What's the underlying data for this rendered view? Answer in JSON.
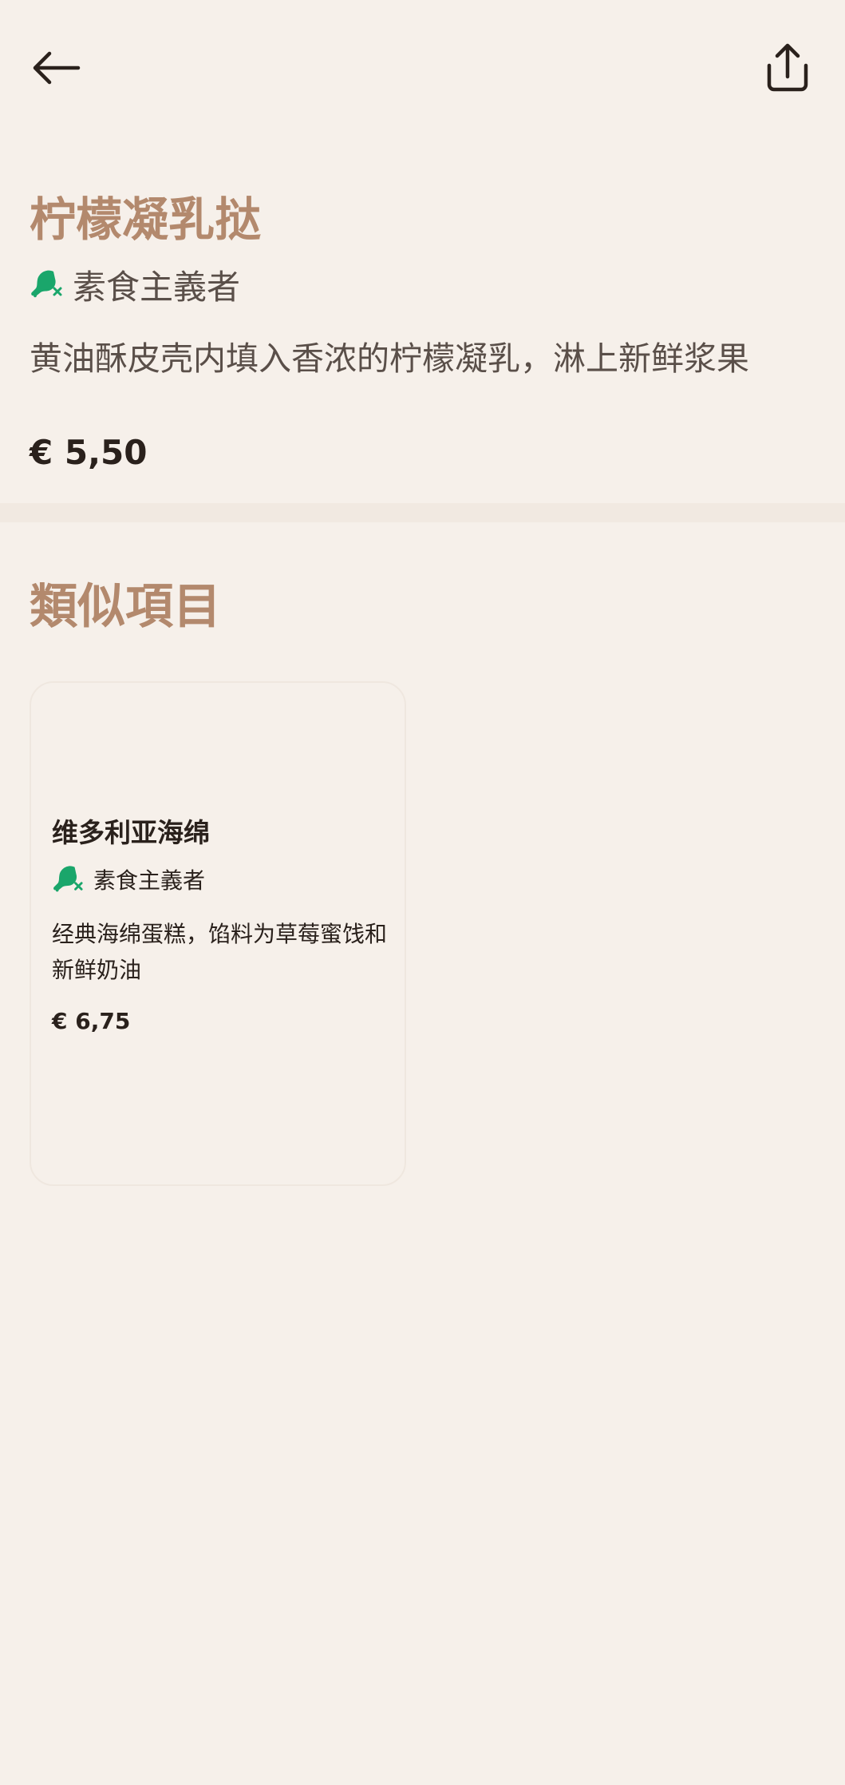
{
  "header": {
    "back_icon": "arrow-left-icon",
    "share_icon": "share-upload-icon"
  },
  "item": {
    "title": "柠檬凝乳挞",
    "diet_icon": "vegetarian-no-meat-icon",
    "diet_label": "素食主義者",
    "description": "黄油酥皮壳内填入香浓的柠檬凝乳，淋上新鲜浆果",
    "price": "€ 5,50"
  },
  "similar": {
    "title": "類似項目",
    "items": [
      {
        "title": "维多利亚海绵",
        "diet_label": "素食主義者",
        "description": "经典海绵蛋糕，馅料为草莓蜜饯和新鲜奶油",
        "price": "€ 6,75"
      }
    ]
  },
  "colors": {
    "background": "#f6f0ea",
    "accent": "#b3896d",
    "diet_icon": "#1aa66b",
    "text": "#2a211c",
    "muted_text": "#5a4f49"
  }
}
